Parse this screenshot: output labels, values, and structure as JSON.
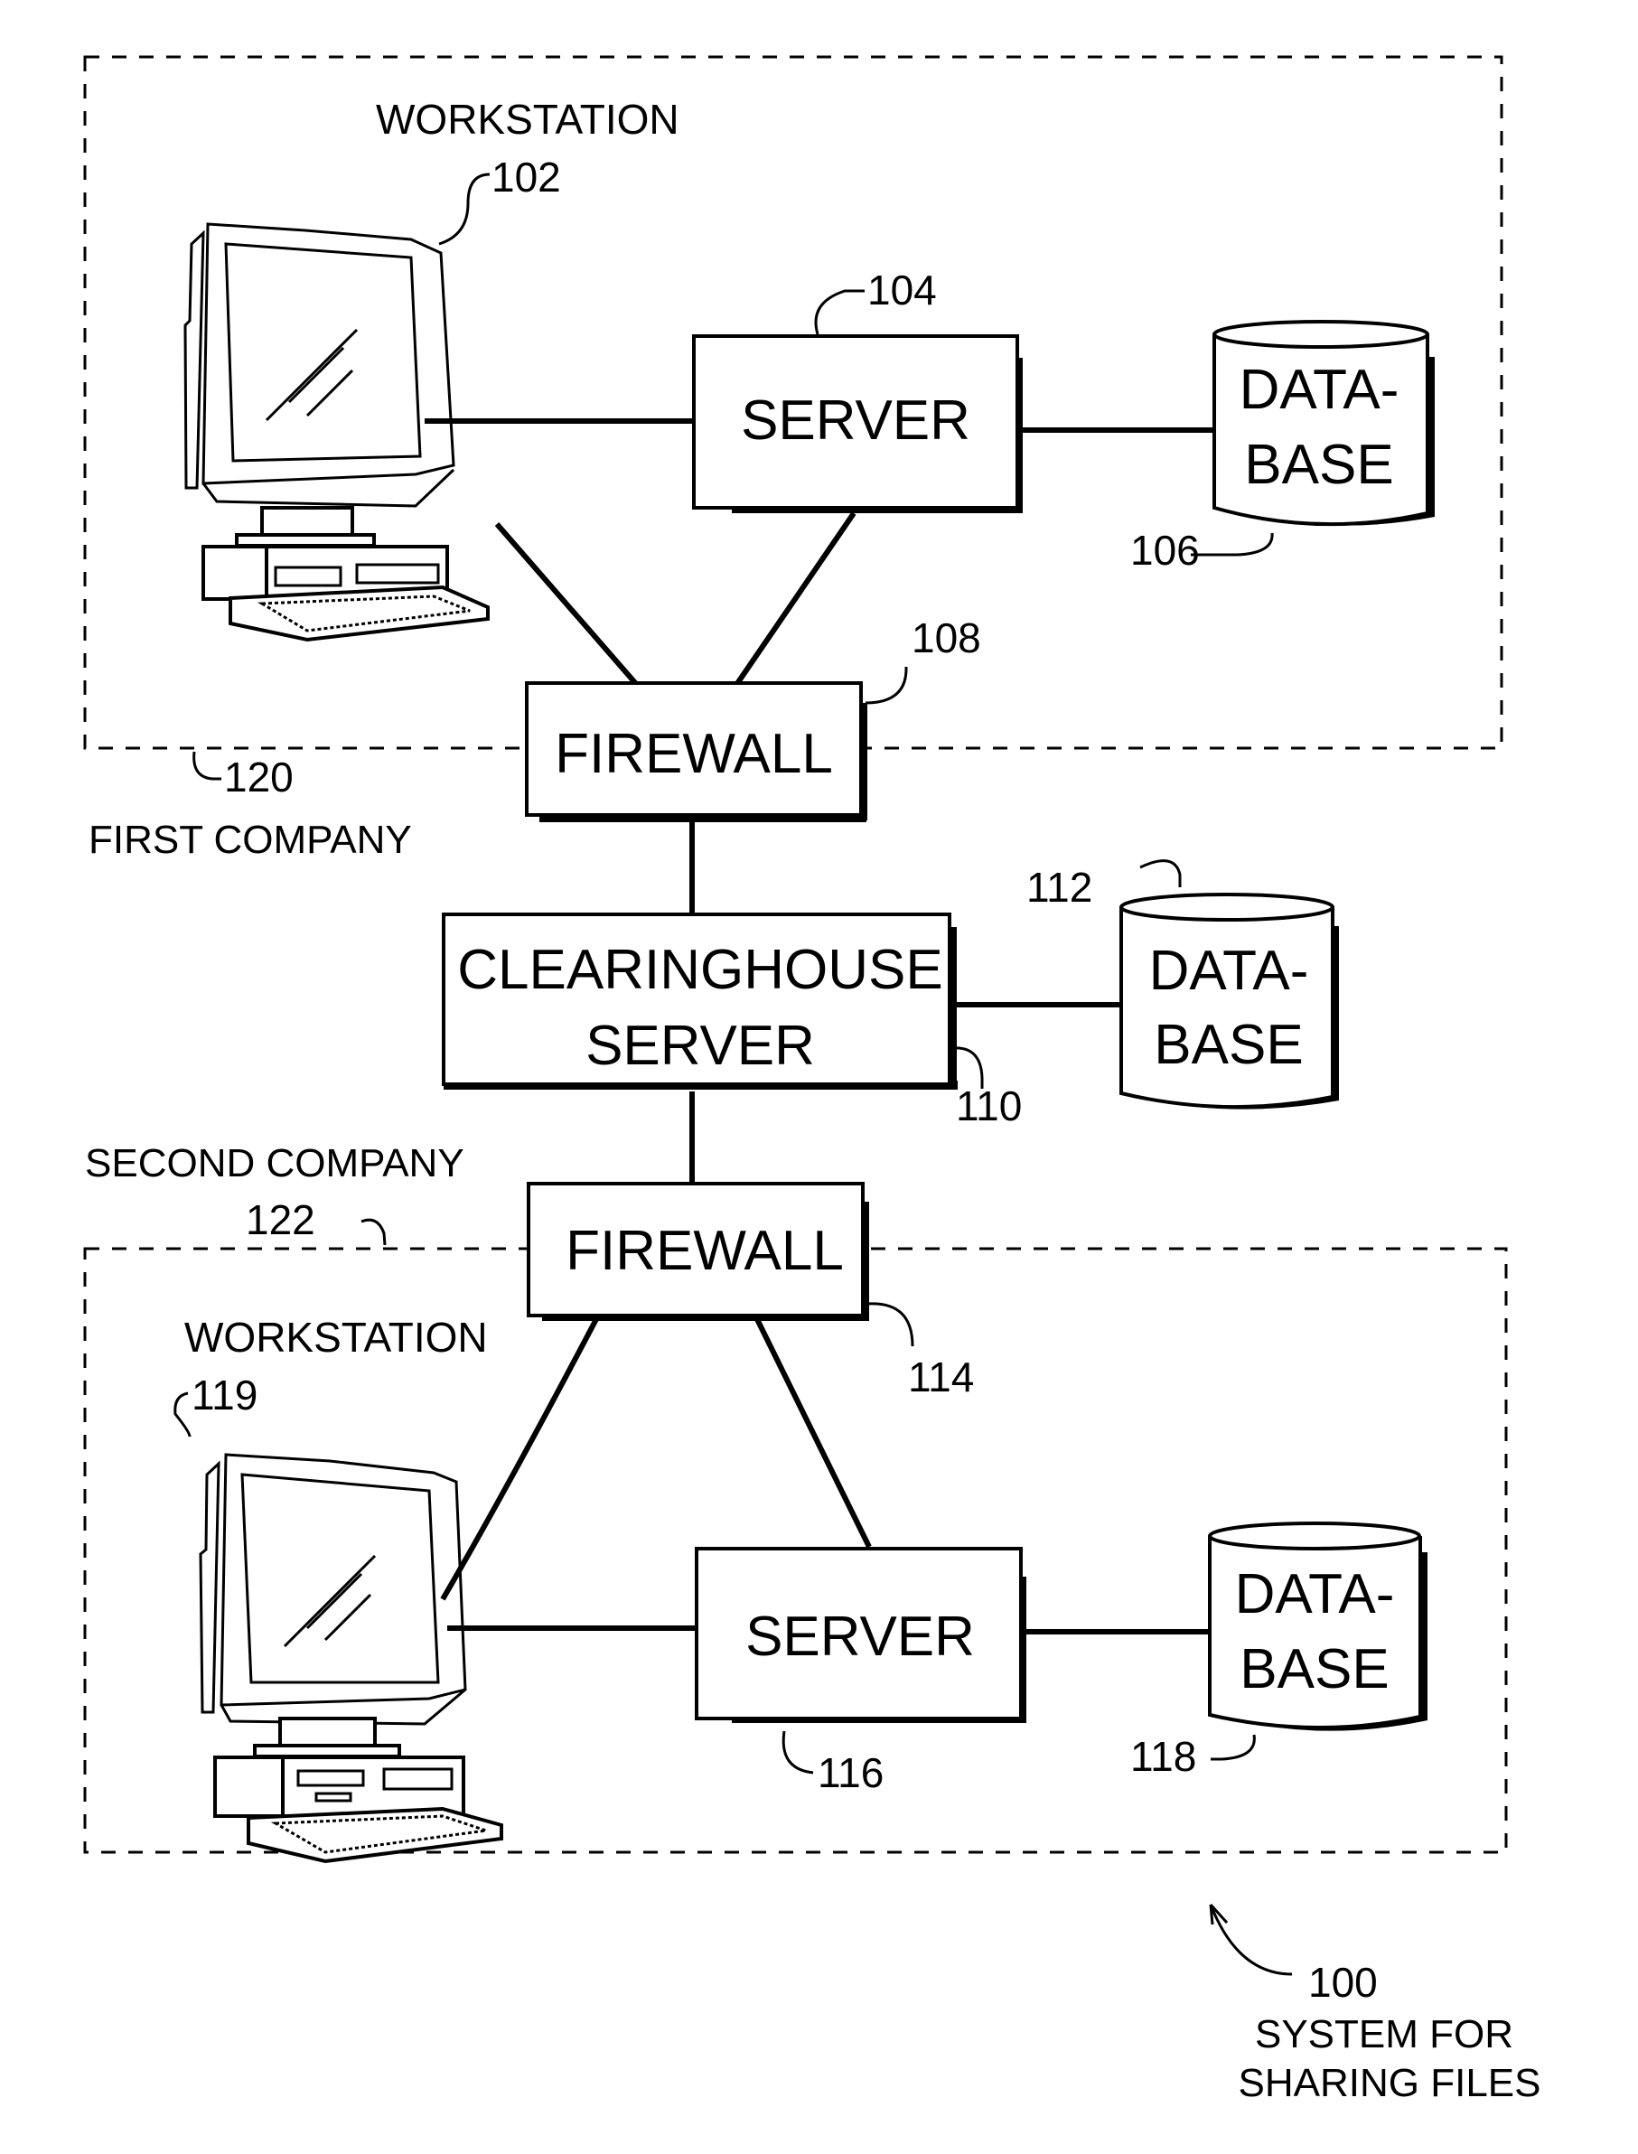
{
  "figure": {
    "title": "SYSTEM FOR SHARING FILES",
    "ref": "100",
    "caption_lines": [
      "SYSTEM FOR",
      "SHARING FILES"
    ]
  },
  "groups": {
    "first_company": {
      "label": "FIRST COMPANY",
      "ref": "120"
    },
    "second_company": {
      "label": "SECOND COMPANY",
      "ref": "122"
    }
  },
  "nodes": {
    "workstation_1": {
      "label": "WORKSTATION",
      "ref": "102"
    },
    "server_1": {
      "label": "SERVER",
      "ref": "104"
    },
    "database_1": {
      "label_lines": [
        "DATA-",
        "BASE"
      ],
      "ref": "106"
    },
    "firewall_1": {
      "label": "FIREWALL",
      "ref": "108"
    },
    "clearinghouse": {
      "label_lines": [
        "CLEARINGHOUSE",
        "SERVER"
      ],
      "ref": "110"
    },
    "database_central": {
      "label_lines": [
        "DATA-",
        "BASE"
      ],
      "ref": "112"
    },
    "firewall_2": {
      "label": "FIREWALL",
      "ref": "114"
    },
    "server_2": {
      "label": "SERVER",
      "ref": "116"
    },
    "database_2": {
      "label_lines": [
        "DATA-",
        "BASE"
      ],
      "ref": "118"
    },
    "workstation_2": {
      "label": "WORKSTATION",
      "ref": "119"
    }
  },
  "connections": [
    [
      "workstation_1",
      "server_1"
    ],
    [
      "server_1",
      "database_1"
    ],
    [
      "workstation_1",
      "firewall_1"
    ],
    [
      "server_1",
      "firewall_1"
    ],
    [
      "firewall_1",
      "clearinghouse"
    ],
    [
      "clearinghouse",
      "database_central"
    ],
    [
      "clearinghouse",
      "firewall_2"
    ],
    [
      "firewall_2",
      "workstation_2"
    ],
    [
      "firewall_2",
      "server_2"
    ],
    [
      "workstation_2",
      "server_2"
    ],
    [
      "server_2",
      "database_2"
    ]
  ]
}
